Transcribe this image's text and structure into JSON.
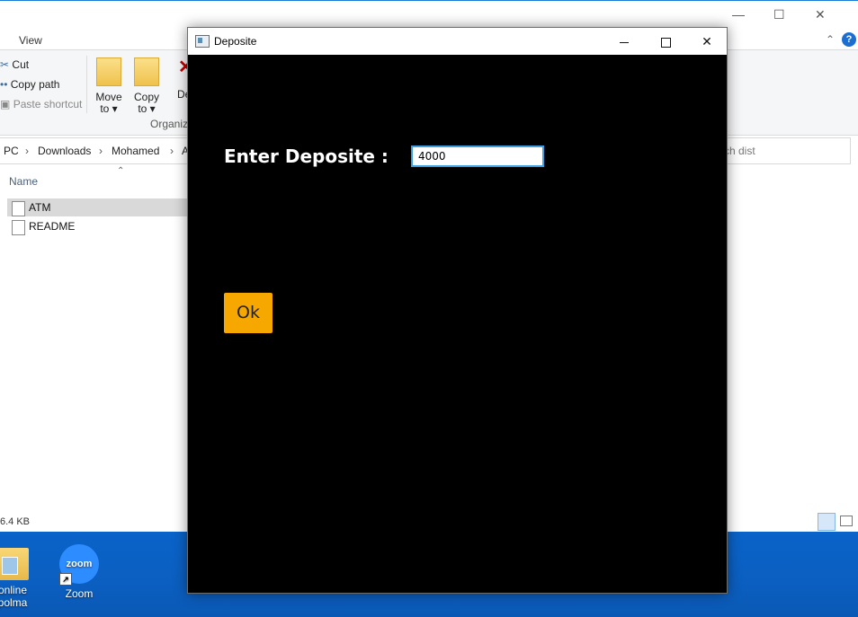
{
  "explorer": {
    "ribbon_tab_view": "View",
    "cut": "Cut",
    "copy_path": "Copy path",
    "paste_shortcut": "Paste shortcut",
    "move_to": "Move",
    "move_to2": "to ▾",
    "copy_to": "Copy",
    "copy_to2": "to ▾",
    "delete_partial": "De",
    "organize": "Organiz",
    "breadcrumb": [
      "PC",
      "Downloads",
      "Mohamed",
      "A"
    ],
    "search_placeholder": "ch dist",
    "column_name": "Name",
    "files": [
      "ATM",
      "README"
    ],
    "status_size": "6.4 KB"
  },
  "desktop": {
    "icons": [
      {
        "label_line1": "online",
        "label_line2": "polma"
      },
      {
        "label_line1": "Zoom",
        "logo_text": "zoom"
      }
    ]
  },
  "dialog": {
    "title": "Deposite",
    "label": "Enter Deposite :",
    "input_value": "4000",
    "ok_label": "Ok",
    "ok_color": "#f7a800",
    "background": "#000000"
  }
}
